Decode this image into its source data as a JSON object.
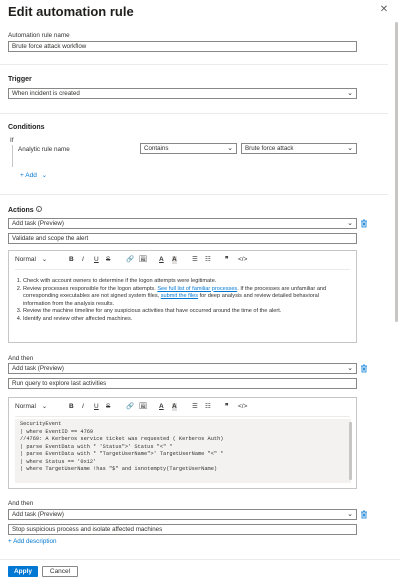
{
  "header": {
    "title": "Edit automation rule",
    "close_glyph": "✕"
  },
  "rule_name": {
    "label": "Automation rule name",
    "value": "Brute force attack workflow"
  },
  "trigger": {
    "heading": "Trigger",
    "value": "When incident is created"
  },
  "conditions": {
    "heading": "Conditions",
    "if_label": "If",
    "property": "Analytic rule name",
    "operator": "Contains",
    "value": "Brute force attack",
    "add_label": "+ Add"
  },
  "actions": {
    "heading": "Actions",
    "action1": {
      "type": "Add task (Preview)",
      "task_name": "Validate and scope the alert"
    },
    "action2": {
      "type": "Add task (Preview)",
      "task_name": "Run query to explore last activities"
    },
    "action3": {
      "type": "Add task (Preview)",
      "task_name": "Stop suspicious process and isolate affected machines"
    },
    "and_then_label": "And then",
    "add_description": "+ Add description"
  },
  "toolbar": {
    "style_label": "Normal",
    "bold": "B",
    "italic": "I",
    "underline": "U",
    "strike": "S",
    "link": "🔗",
    "image": "🖼",
    "fontcolor": "A",
    "highlight": "A",
    "bullets": "☰",
    "numbers": "☷",
    "quote": "❞",
    "code": "</>"
  },
  "steps": {
    "s1": "Check with account owners to determine if the logon attempts were legitimate.",
    "s2a": "Review processes responsible for the logon attempts. ",
    "s2link1": "See full list of familiar processes",
    "s2b": ". If the processes are unfamiliar and corresponding executables are not signed system files, ",
    "s2link2": "submit the files",
    "s2c": " for deep analysis and review detailed behavioral information from the analysis results.",
    "s3": "Review the machine timeline for any suspicious activities that have occurred around the time of the alert.",
    "s4": "Identify and review other affected machines."
  },
  "query": {
    "l1": "SecurityEvent",
    "l2": "| where EventID == 4769",
    "l3": "//4769: A Kerberos service ticket was requested ( Kerberos Auth)",
    "l4": "| parse EventData with * 'Status\">' Status \"<\" *",
    "l5": "| parse EventData with * \"TargetUserName\">' TargetUserName \"<\" *",
    "l6": "| where Status == '0x12'",
    "l7": "| where TargetUserName !has \"$\" and isnotempty(TargetUserName)"
  },
  "footer": {
    "apply": "Apply",
    "cancel": "Cancel"
  },
  "colors": {
    "accent": "#0078d4",
    "border": "#8a8886",
    "divider": "#edebe9"
  }
}
